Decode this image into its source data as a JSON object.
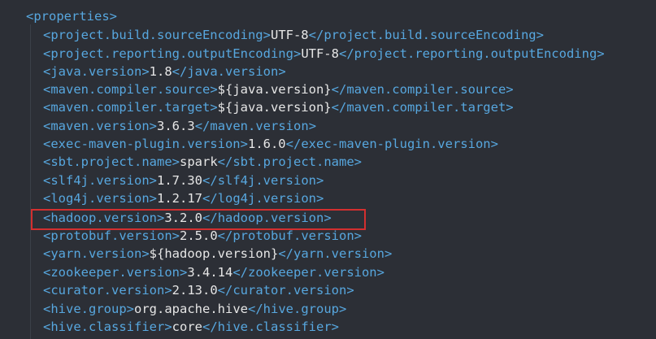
{
  "editor": {
    "root_tag": "properties",
    "lines": [
      {
        "tag": "project.build.sourceEncoding",
        "value": "UTF-8"
      },
      {
        "tag": "project.reporting.outputEncoding",
        "value": "UTF-8"
      },
      {
        "tag": "java.version",
        "value": "1.8"
      },
      {
        "tag": "maven.compiler.source",
        "value": "${java.version}"
      },
      {
        "tag": "maven.compiler.target",
        "value": "${java.version}"
      },
      {
        "tag": "maven.version",
        "value": "3.6.3"
      },
      {
        "tag": "exec-maven-plugin.version",
        "value": "1.6.0"
      },
      {
        "tag": "sbt.project.name",
        "value": "spark"
      },
      {
        "tag": "slf4j.version",
        "value": "1.7.30"
      },
      {
        "tag": "log4j.version",
        "value": "1.2.17"
      },
      {
        "tag": "hadoop.version",
        "value": "3.2.0"
      },
      {
        "tag": "protobuf.version",
        "value": "2.5.0"
      },
      {
        "tag": "yarn.version",
        "value": "${hadoop.version}"
      },
      {
        "tag": "zookeeper.version",
        "value": "3.4.14"
      },
      {
        "tag": "curator.version",
        "value": "2.13.0"
      },
      {
        "tag": "hive.group",
        "value": "org.apache.hive"
      },
      {
        "tag": "hive.classifier",
        "value": "core"
      }
    ],
    "highlighted_line": "hadoop.version"
  },
  "colors": {
    "background": "#2c2f36",
    "tag": "#57a7df",
    "text": "#e6e6e6",
    "highlight_border": "#d32f2f"
  }
}
